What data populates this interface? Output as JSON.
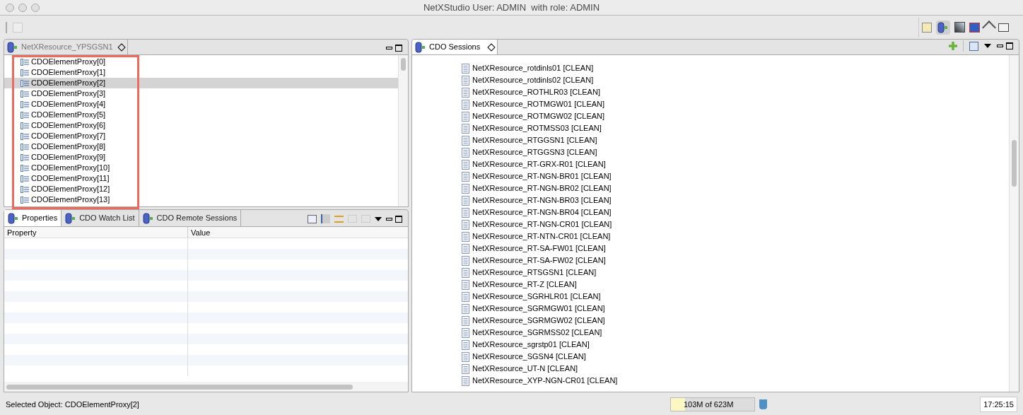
{
  "window": {
    "title": "NetXStudio User: ADMIN  with role: ADMIN"
  },
  "editor": {
    "tab": {
      "label": "NetXResource_YPSGSN1",
      "selected": false
    },
    "items": [
      {
        "label": "CDOElementProxy[0]",
        "selected": false
      },
      {
        "label": "CDOElementProxy[1]",
        "selected": false
      },
      {
        "label": "CDOElementProxy[2]",
        "selected": true
      },
      {
        "label": "CDOElementProxy[3]",
        "selected": false
      },
      {
        "label": "CDOElementProxy[4]",
        "selected": false
      },
      {
        "label": "CDOElementProxy[5]",
        "selected": false
      },
      {
        "label": "CDOElementProxy[6]",
        "selected": false
      },
      {
        "label": "CDOElementProxy[7]",
        "selected": false
      },
      {
        "label": "CDOElementProxy[8]",
        "selected": false
      },
      {
        "label": "CDOElementProxy[9]",
        "selected": false
      },
      {
        "label": "CDOElementProxy[10]",
        "selected": false
      },
      {
        "label": "CDOElementProxy[11]",
        "selected": false
      },
      {
        "label": "CDOElementProxy[12]",
        "selected": false
      },
      {
        "label": "CDOElementProxy[13]",
        "selected": false
      }
    ]
  },
  "bottom_panel": {
    "tabs": [
      {
        "label": "Properties",
        "selected": true
      },
      {
        "label": "CDO Watch List",
        "selected": false
      },
      {
        "label": "CDO Remote Sessions",
        "selected": false
      }
    ],
    "table": {
      "columns": [
        "Property",
        "Value"
      ]
    }
  },
  "sessions": {
    "tab": {
      "label": "CDO Sessions",
      "selected": true
    },
    "items": [
      "NetXResource_rotdinls01 [CLEAN]",
      "NetXResource_rotdinls02 [CLEAN]",
      "NetXResource_ROTHLR03 [CLEAN]",
      "NetXResource_ROTMGW01 [CLEAN]",
      "NetXResource_ROTMGW02 [CLEAN]",
      "NetXResource_ROTMSS03 [CLEAN]",
      "NetXResource_RTGGSN1 [CLEAN]",
      "NetXResource_RTGGSN3 [CLEAN]",
      "NetXResource_RT-GRX-R01 [CLEAN]",
      "NetXResource_RT-NGN-BR01 [CLEAN]",
      "NetXResource_RT-NGN-BR02 [CLEAN]",
      "NetXResource_RT-NGN-BR03 [CLEAN]",
      "NetXResource_RT-NGN-BR04 [CLEAN]",
      "NetXResource_RT-NGN-CR01 [CLEAN]",
      "NetXResource_RT-NTN-CR01 [CLEAN]",
      "NetXResource_RT-SA-FW01 [CLEAN]",
      "NetXResource_RT-SA-FW02 [CLEAN]",
      "NetXResource_RTSGSN1 [CLEAN]",
      "NetXResource_RT-Z [CLEAN]",
      "NetXResource_SGRHLR01 [CLEAN]",
      "NetXResource_SGRMGW01 [CLEAN]",
      "NetXResource_SGRMGW02 [CLEAN]",
      "NetXResource_SGRMSS02 [CLEAN]",
      "NetXResource_sgrstp01 [CLEAN]",
      "NetXResource_SGSN4 [CLEAN]",
      "NetXResource_UT-N [CLEAN]",
      "NetXResource_XYP-NGN-CR01 [CLEAN]"
    ]
  },
  "status_bar": {
    "selected_object": "Selected Object: CDOElementProxy[2]",
    "memory": {
      "text": "103M of 623M",
      "level": 0.17
    },
    "time": "17:25:15"
  }
}
